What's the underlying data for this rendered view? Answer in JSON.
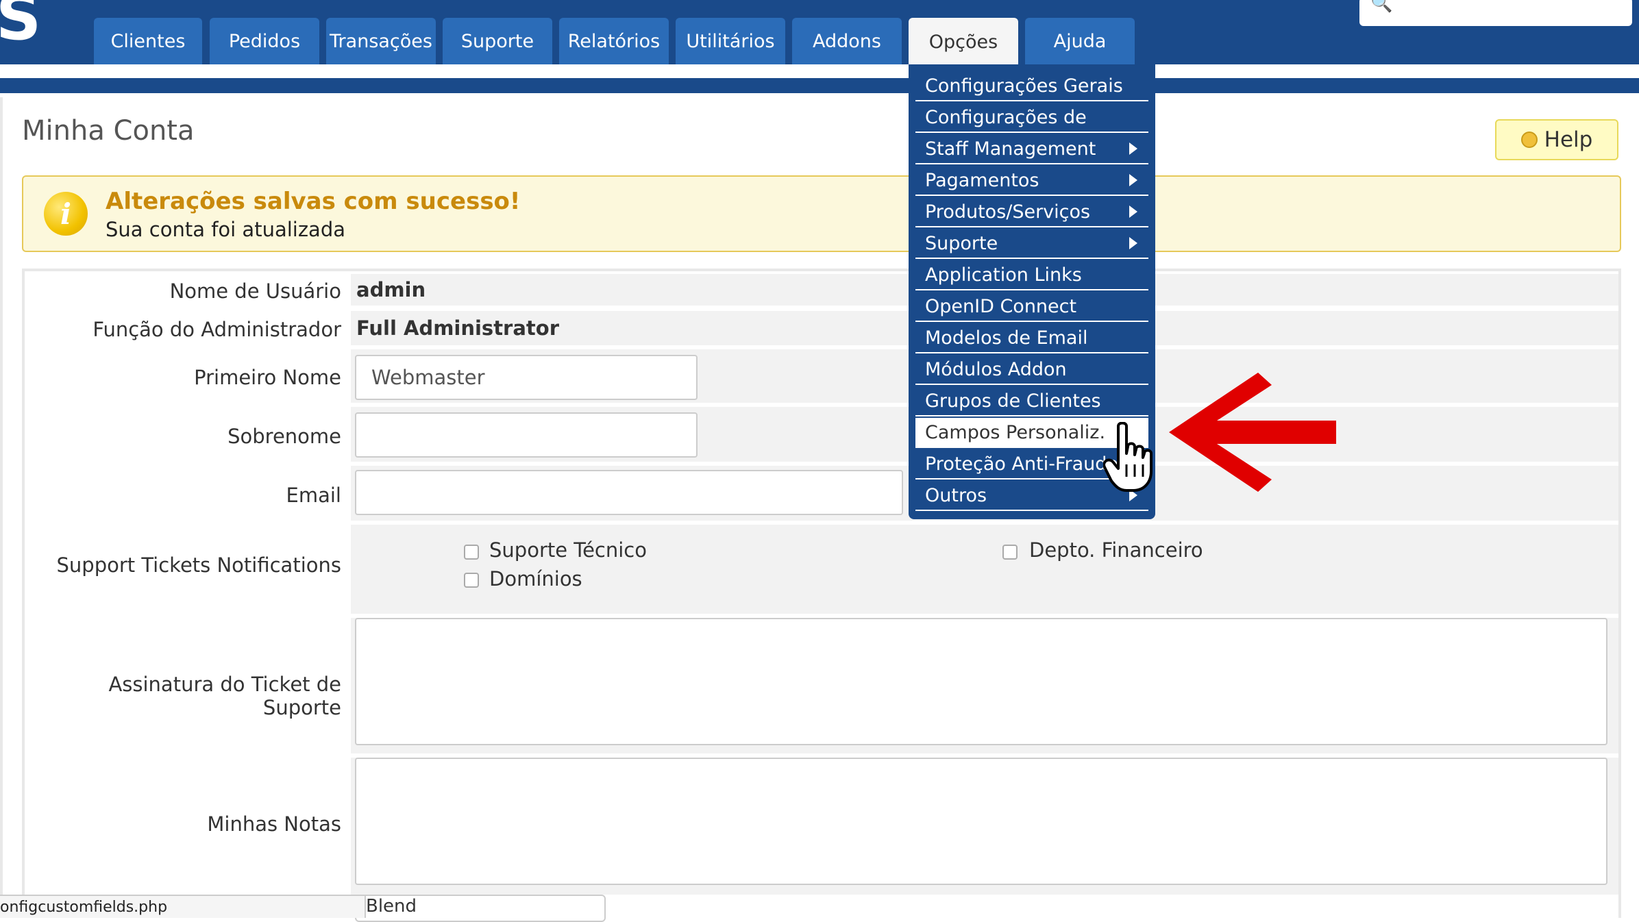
{
  "app": {
    "logo_char": "S"
  },
  "nav": {
    "tabs": [
      {
        "label": "Clientes"
      },
      {
        "label": "Pedidos"
      },
      {
        "label": "Transações"
      },
      {
        "label": "Suporte"
      },
      {
        "label": "Relatórios"
      },
      {
        "label": "Utilitários"
      },
      {
        "label": "Addons"
      },
      {
        "label": "Opções"
      },
      {
        "label": "Ajuda"
      }
    ],
    "active_tab": "Opções",
    "search_icon": "search-icon"
  },
  "dropdown": {
    "items": [
      {
        "label": "Configurações Gerais",
        "submenu": false
      },
      {
        "label": "Configurações de",
        "submenu": false
      },
      {
        "label": "Staff Management",
        "submenu": true
      },
      {
        "label": "Pagamentos",
        "submenu": true
      },
      {
        "label": "Produtos/Serviços",
        "submenu": true
      },
      {
        "label": "Suporte",
        "submenu": true
      },
      {
        "label": "Application Links",
        "submenu": false
      },
      {
        "label": "OpenID Connect",
        "submenu": false
      },
      {
        "label": "Modelos de Email",
        "submenu": false
      },
      {
        "label": "Módulos Addon",
        "submenu": false
      },
      {
        "label": "Grupos de Clientes",
        "submenu": false
      },
      {
        "label": "Campos Personaliz.",
        "submenu": false,
        "hover": true
      },
      {
        "label": "Proteção Anti-Fraude",
        "submenu": false
      },
      {
        "label": "Outros",
        "submenu": true
      }
    ]
  },
  "page": {
    "title": "Minha Conta",
    "help_label": "Help"
  },
  "alert": {
    "title": "Alterações salvas com sucesso!",
    "text": "Sua conta foi atualizada",
    "icon_char": "i"
  },
  "form": {
    "username_label": "Nome de Usuário",
    "username_value": "admin",
    "role_label": "Função do Administrador",
    "role_value": "Full Administrator",
    "firstname_label": "Primeiro Nome",
    "firstname_value": "Webmaster",
    "lastname_label": "Sobrenome",
    "lastname_value": "",
    "email_label": "Email",
    "email_value": "",
    "notifications_label": "Support Tickets Notifications",
    "notifications": [
      {
        "label": "Suporte Técnico",
        "checked": false
      },
      {
        "label": "Domínios",
        "checked": false
      },
      {
        "label": "Depto. Financeiro",
        "checked": false
      }
    ],
    "signature_label": "Assinatura do Ticket de Suporte",
    "notes_label": "Minhas Notas"
  },
  "statusbar": {
    "text": "onfigcustomfields.php"
  },
  "select_peek": {
    "value": "Blend"
  },
  "colors": {
    "nav_bg": "#1a4a8a",
    "tab_bg": "#2b6cb8",
    "alert_title": "#c98a0c",
    "arrow_red": "#e00000"
  }
}
